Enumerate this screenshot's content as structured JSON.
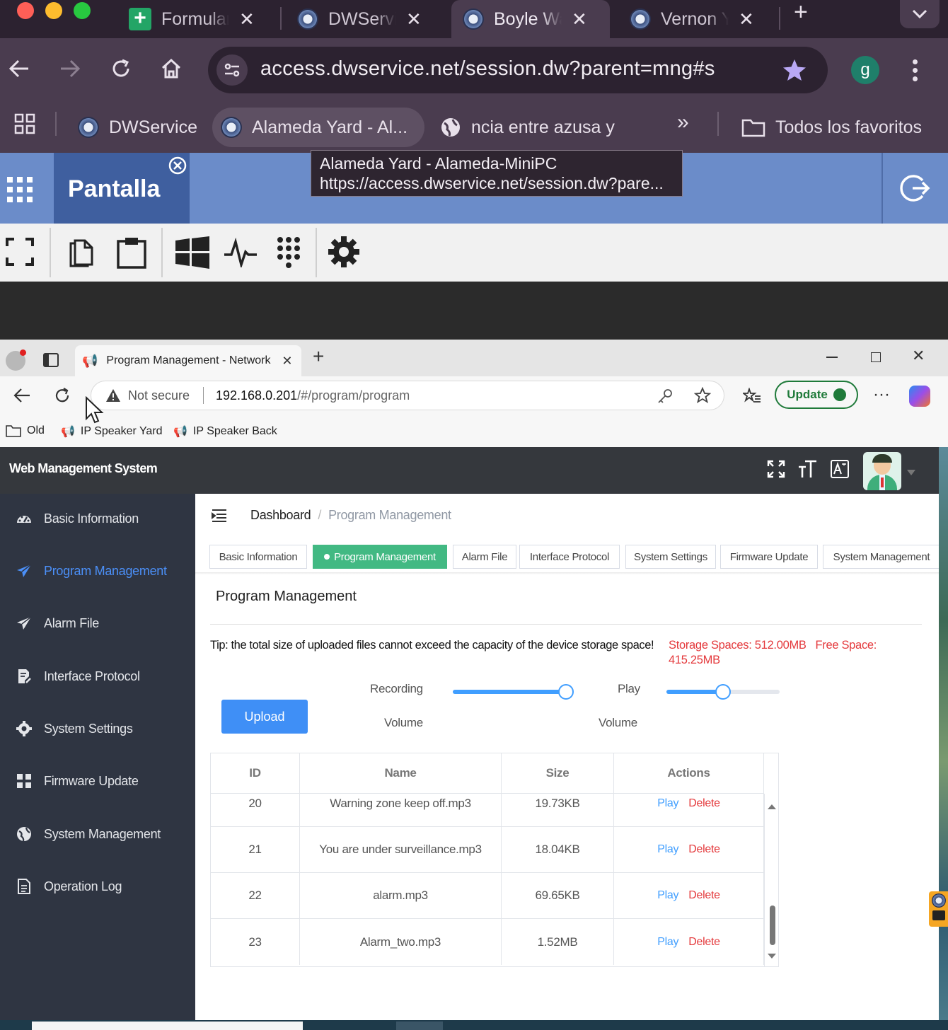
{
  "mac_tabs": [
    {
      "title": "Formulario",
      "icon": "sheets-icon"
    },
    {
      "title": "DWService",
      "icon": "dwservice-icon"
    },
    {
      "title": "Boyle Way",
      "icon": "dwservice-icon",
      "active": true
    },
    {
      "title": "Vernon Yard",
      "icon": "dwservice-icon"
    }
  ],
  "mac_address": {
    "url": "access.dwservice.net/session.dw?parent=mng#s",
    "profile_initial": "g"
  },
  "mac_bookmarks": {
    "items": [
      "DWService",
      "Alameda Yard - Al...",
      "ncia entre azusa y"
    ],
    "more": "»",
    "all_bookmarks": "Todos los favoritos"
  },
  "tooltip": {
    "line1": "Alameda Yard - Alameda-MiniPC",
    "line2": "https://access.dwservice.net/session.dw?pare..."
  },
  "dwservice": {
    "tab_label": "Pantalla"
  },
  "edge": {
    "tab_title": "Program Management - Network",
    "not_secure": "Not secure",
    "url_host": "192.168.0.201",
    "url_path": "/#/program/program",
    "update_label": "Update",
    "bookmarks": [
      "Old",
      "IP Speaker Yard",
      "IP Speaker Back"
    ]
  },
  "wms": {
    "title": "Web Management System",
    "sidebar": [
      {
        "label": "Basic Information",
        "icon": "dashboard-icon"
      },
      {
        "label": "Program Management",
        "icon": "send-icon",
        "active": true
      },
      {
        "label": "Alarm File",
        "icon": "send-icon"
      },
      {
        "label": "Interface Protocol",
        "icon": "document-edit-icon"
      },
      {
        "label": "System Settings",
        "icon": "gear-icon"
      },
      {
        "label": "Firmware Update",
        "icon": "grid-icon"
      },
      {
        "label": "System Management",
        "icon": "globe-icon"
      },
      {
        "label": "Operation Log",
        "icon": "log-icon"
      }
    ],
    "breadcrumb": {
      "home": "Dashboard",
      "separator": "/",
      "current": "Program Management"
    },
    "tags": [
      "Basic Information",
      "Program Management",
      "Alarm File",
      "Interface Protocol",
      "System Settings",
      "Firmware Update",
      "System Management"
    ],
    "active_tag": "Program Management",
    "card_title": "Program Management",
    "tip": "Tip: the total size of uploaded files cannot exceed the capacity of the device storage space!",
    "storage_spaces": "Storage Spaces: 512.00MB",
    "free_space": "Free Space: 415.25MB",
    "upload_label": "Upload",
    "recording_volume": {
      "label_top": "Recording",
      "label_bottom": "Volume",
      "level": 0.95
    },
    "play_volume": {
      "label_top": "Play",
      "label_bottom": "Volume",
      "level": 0.5
    },
    "table": {
      "columns": [
        "ID",
        "Name",
        "Size",
        "Actions"
      ],
      "play_label": "Play",
      "delete_label": "Delete",
      "rows": [
        {
          "id": "20",
          "name": "Warning zone keep off.mp3",
          "size": "19.73KB"
        },
        {
          "id": "21",
          "name": "You are under surveillance.mp3",
          "size": "18.04KB"
        },
        {
          "id": "22",
          "name": "alarm.mp3",
          "size": "69.65KB"
        },
        {
          "id": "23",
          "name": "Alarm_two.mp3",
          "size": "1.52MB"
        }
      ]
    }
  },
  "colors": {
    "accent_blue": "#409eff",
    "active_tag_green": "#42b983",
    "danger_red": "#e4393c",
    "sidebar_bg": "#2f3542",
    "header_bg": "#35383d",
    "dwservice_blue": "#6b8cc9"
  }
}
